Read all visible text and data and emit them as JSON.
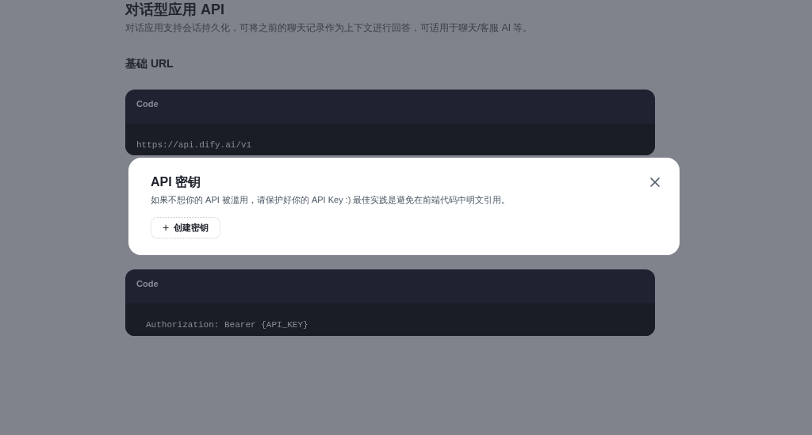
{
  "page": {
    "title": "对话型应用 API",
    "description": "对话应用支持会话持久化，可将之前的聊天记录作为上下文进行回答，可适用于聊天/客服 AI 等。"
  },
  "base_url": {
    "heading": "基础 URL",
    "code_label": "Code",
    "code": "https://api.dify.ai/v1"
  },
  "auth_code": {
    "code_label": "Code",
    "code": "Authorization: Bearer {API_KEY}"
  },
  "modal": {
    "title": "API 密钥",
    "description": "如果不想你的 API 被滥用，请保护好你的 API Key :) 最佳实践是避免在前端代码中明文引用。",
    "button": "创建密钥",
    "button_icon": "+"
  }
}
